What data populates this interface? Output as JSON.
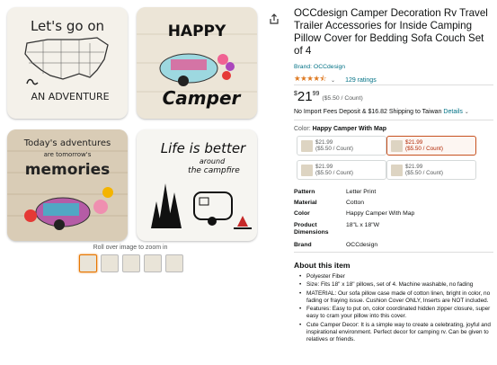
{
  "gallery": {
    "pillows": [
      {
        "line1": "Let's go on",
        "line2": "AN ADVENTURE"
      },
      {
        "line1": "HAPPY",
        "line2": "Camper"
      },
      {
        "line1": "Today's adventures",
        "line2": "are tomorrow's",
        "line3": "memories"
      },
      {
        "line1": "Life is better",
        "line2": "around",
        "line3": "the campfire"
      }
    ],
    "zoom_hint": "Roll over image to zoom in"
  },
  "product": {
    "title": "OCCdesign Camper Decoration Rv Travel Trailer Accessories for Inside Camping Pillow Cover for Bedding Sofa Couch Set of 4",
    "brand_link": "Brand: OCCdesign",
    "stars": "★★★★⯪",
    "ratings": "129 ratings",
    "price": {
      "symbol": "$",
      "whole": "21",
      "fraction": "99",
      "per_unit": "($5.50 / Count)"
    },
    "shipping_text": "No Import Fees Deposit & $16.82 Shipping to Taiwan",
    "shipping_link": "Details",
    "color_label": "Color:",
    "color_value": "Happy Camper With Map",
    "options": [
      {
        "price": "$21.99",
        "unit": "($5.50 / Count)"
      },
      {
        "price": "$21.99",
        "unit": "($5.50 / Count)"
      },
      {
        "price": "$21.99",
        "unit": "($5.50 / Count)"
      },
      {
        "price": "$21.99",
        "unit": "($5.50 / Count)"
      }
    ],
    "specs": [
      {
        "key": "Pattern",
        "value": "Letter Print"
      },
      {
        "key": "Material",
        "value": "Cotton"
      },
      {
        "key": "Color",
        "value": "Happy Camper With Map"
      },
      {
        "key": "Product Dimensions",
        "value": "18\"L x 18\"W"
      },
      {
        "key": "Brand",
        "value": "OCCdesign"
      }
    ]
  },
  "about": {
    "title": "About this item",
    "bullets": [
      "Polyester Fiber",
      "Size: Fits 18\" x 18\" pillows, set of 4. Machine washable, no fading",
      "MATERIAL: Our sofa pillow case made of cotton linen, bright in color, no fading or fraying issue. Cushion Cover ONLY, Inserts are NOT included.",
      "Features: Easy to put on, color coordinated hidden zipper closure, super easy to cram your pillow into this cover.",
      "Cute Camper Decor: It is a simple way to create a celebrating, joyful and inspirational environment. Perfect decor for camping rv. Can be given to relatives or friends."
    ]
  },
  "colors": {
    "link": "#007185",
    "star": "#de7921",
    "selected_border": "#c7511f",
    "price_red": "#b12704"
  }
}
